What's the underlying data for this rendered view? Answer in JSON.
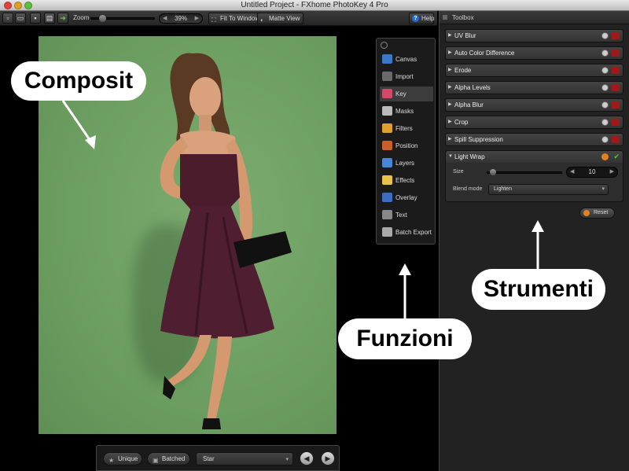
{
  "window": {
    "title": "Untitled Project - FXhome PhotoKey 4 Pro"
  },
  "toolbar": {
    "zoom_label": "Zoom",
    "zoom_value": "39%",
    "fit_label": "Fit To Window",
    "matte_label": "Matte View",
    "help_label": "Help"
  },
  "functions": {
    "items": [
      "Canvas",
      "Import",
      "Key",
      "Masks",
      "Filters",
      "Position",
      "Layers",
      "Effects",
      "Overlay",
      "Text",
      "Batch Export"
    ],
    "active": "Key",
    "colors": [
      "#3a78c9",
      "#6a6a6a",
      "#d04a6a",
      "#bbbbbb",
      "#e0a030",
      "#c9602a",
      "#4a86d6",
      "#e8c24a",
      "#3a6ec0",
      "#888888",
      "#aaaaaa"
    ]
  },
  "toolbox": {
    "title": "Toolbox",
    "tools": [
      "UV Blur",
      "Auto Color Difference",
      "Erode",
      "Alpha Levels",
      "Alpha Blur",
      "Crop",
      "Spill Suppression"
    ],
    "light_wrap": {
      "title": "Light Wrap",
      "size_label": "Size",
      "size_value": "10",
      "blend_label": "Blend mode",
      "blend_value": "Lighten"
    },
    "reset_label": "Reset"
  },
  "bottom": {
    "unique_label": "Unique",
    "batched_label": "Batched",
    "select_value": "Star"
  },
  "callouts": {
    "composit": "Composit",
    "funzioni": "Funzioni",
    "strumenti": "Strumenti"
  },
  "colors": {
    "green_screen": "#6e9f62",
    "dress": "#4a1c2c",
    "skin": "#d9a27c",
    "hair": "#5a3a22"
  }
}
